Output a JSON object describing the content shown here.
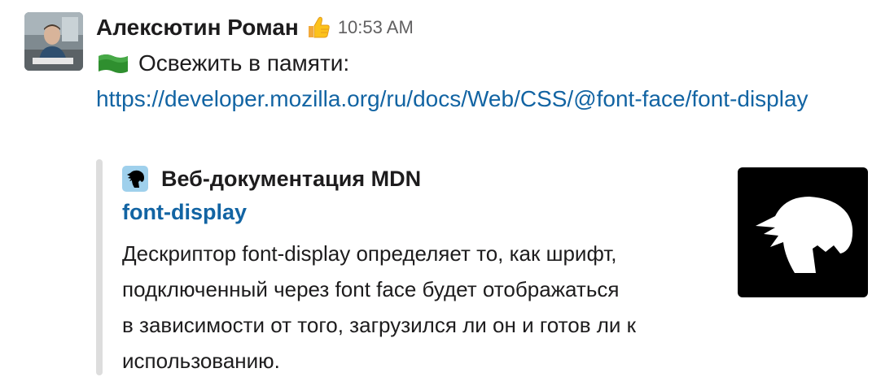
{
  "message": {
    "author": "Алексютин Роман",
    "status_emoji": "thumbs-up-icon",
    "timestamp": "10:53 AM",
    "body_emoji": "flag-icon",
    "body_text": "Освежить в памяти:",
    "link": "https://developer.mozilla.org/ru/docs/Web/CSS/@font-face/font-display"
  },
  "attachment": {
    "service_name": "Веб-документация MDN",
    "service_icon": "mdn-dino-icon",
    "title": "font-display",
    "description_lines": [
      "Дескриптор font-display определяет то, как шрифт,",
      "подключенный через font face будет отображаться",
      "в зависимости от того, загрузился ли он и готов ли к",
      "использованию."
    ],
    "thumbnail_icon": "mdn-dino-icon"
  },
  "colors": {
    "link": "#1264a3",
    "text": "#1d1c1d",
    "muted": "#616061",
    "attachment_bar": "#dddddd",
    "thumbnail_bg": "#000000",
    "service_icon_bg": "#9fd0ec",
    "flag_green": "#2f8f2f"
  }
}
